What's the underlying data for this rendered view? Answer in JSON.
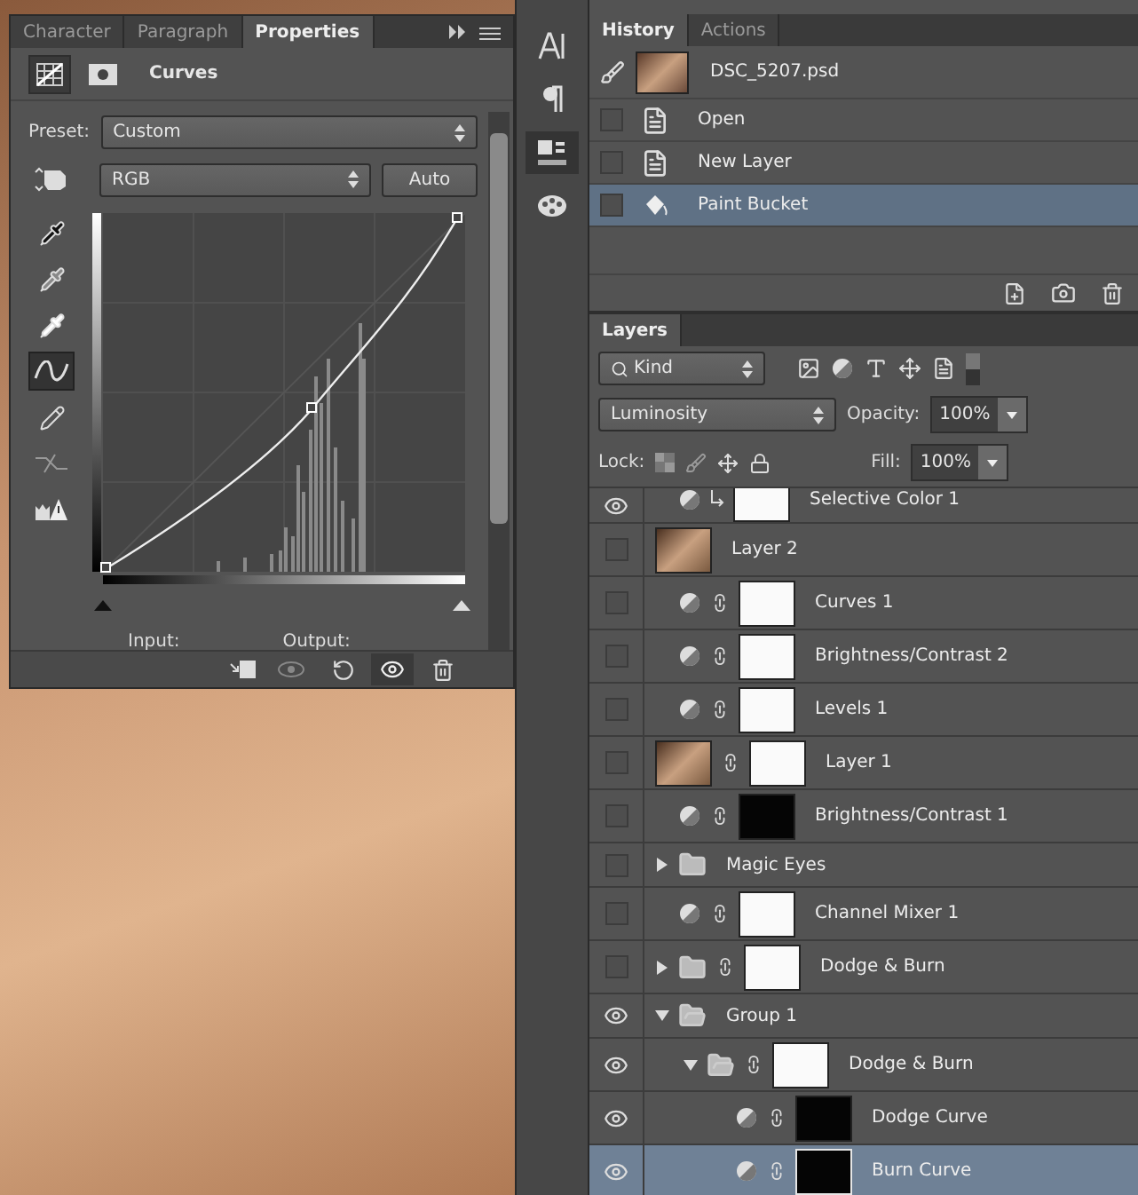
{
  "properties": {
    "tabs": [
      {
        "label": "Character",
        "selected": false
      },
      {
        "label": "Paragraph",
        "selected": false
      },
      {
        "label": "Properties",
        "selected": true
      }
    ],
    "title": "Curves",
    "preset_label": "Preset:",
    "preset": "Custom",
    "channel": "RGB",
    "auto_button": "Auto",
    "tools": [
      {
        "kind": "target-adjust",
        "selected": false
      },
      {
        "kind": "black-point",
        "selected": false
      },
      {
        "kind": "gray-point",
        "selected": false
      },
      {
        "kind": "white-point",
        "selected": false
      },
      {
        "kind": "curve",
        "selected": true
      },
      {
        "kind": "pencil",
        "selected": false
      },
      {
        "kind": "smooth",
        "selected": false
      },
      {
        "kind": "clipping",
        "selected": false
      }
    ],
    "input_label": "Input:",
    "output_label": "Output:",
    "footer_buttons": [
      {
        "kind": "clip",
        "pressed": false
      },
      {
        "kind": "previous",
        "pressed": false
      },
      {
        "kind": "reset",
        "pressed": false
      },
      {
        "kind": "visibility",
        "pressed": true
      },
      {
        "kind": "delete",
        "pressed": false
      }
    ]
  },
  "dock": [
    {
      "kind": "character",
      "selected": false
    },
    {
      "kind": "paragraph",
      "selected": false
    },
    {
      "kind": "properties",
      "selected": true
    },
    {
      "kind": "swatches",
      "selected": false
    }
  ],
  "history": {
    "tabs": [
      {
        "label": "History",
        "selected": true
      },
      {
        "label": "Actions",
        "selected": false
      }
    ],
    "snapshot": "DSC_5207.psd",
    "states": [
      {
        "label": "Open",
        "kind": "document",
        "selected": false
      },
      {
        "label": "New Layer",
        "kind": "document",
        "selected": false
      },
      {
        "label": "Paint Bucket",
        "kind": "bucket",
        "selected": true
      }
    ]
  },
  "layers": {
    "tab": "Layers",
    "filter": "Kind",
    "blend_mode": "Luminosity",
    "opacity_label": "Opacity:",
    "opacity": "100%",
    "lock_label": "Lock:",
    "fill_label": "Fill:",
    "fill": "100%",
    "items": [
      {
        "name": "Selective Color 1",
        "kind": "adjustment",
        "visible": true,
        "clipped": true,
        "mask": true,
        "mask_dark": false,
        "selected": false
      },
      {
        "name": "Layer 2",
        "kind": "pixel",
        "visible": false,
        "clipped": false,
        "mask": false,
        "selected": false
      },
      {
        "name": "Curves 1",
        "kind": "adjustment",
        "visible": false,
        "clipped": false,
        "mask": true,
        "mask_dark": false,
        "selected": false
      },
      {
        "name": "Brightness/Contrast 2",
        "kind": "adjustment",
        "visible": false,
        "clipped": false,
        "mask": true,
        "mask_dark": false,
        "selected": false
      },
      {
        "name": "Levels 1",
        "kind": "adjustment",
        "visible": false,
        "clipped": false,
        "mask": true,
        "mask_dark": false,
        "selected": false
      },
      {
        "name": "Layer 1",
        "kind": "pixel",
        "visible": false,
        "clipped": false,
        "mask": true,
        "mask_dark": false,
        "selected": false
      },
      {
        "name": "Brightness/Contrast 1",
        "kind": "adjustment",
        "visible": false,
        "clipped": false,
        "mask": true,
        "mask_dark": true,
        "selected": false
      },
      {
        "name": "Magic Eyes",
        "kind": "group",
        "visible": false,
        "clipped": false,
        "mask": false,
        "expanded": false,
        "selected": false
      },
      {
        "name": "Channel Mixer 1",
        "kind": "adjustment",
        "visible": false,
        "clipped": false,
        "mask": true,
        "mask_dark": false,
        "selected": false
      },
      {
        "name": "Dodge & Burn",
        "kind": "group",
        "visible": false,
        "clipped": false,
        "mask": true,
        "mask_dark": false,
        "expanded": false,
        "selected": false
      },
      {
        "name": "Group 1",
        "kind": "group",
        "visible": true,
        "clipped": false,
        "mask": false,
        "expanded": true,
        "selected": false,
        "children": [
          {
            "name": "Dodge & Burn",
            "kind": "group",
            "visible": true,
            "clipped": false,
            "mask": true,
            "mask_dark": false,
            "expanded": true,
            "selected": false,
            "children": [
              {
                "name": "Dodge Curve",
                "kind": "adjustment",
                "visible": true,
                "clipped": false,
                "mask": true,
                "mask_dark": true,
                "selected": false
              },
              {
                "name": "Burn Curve",
                "kind": "adjustment",
                "visible": true,
                "clipped": false,
                "mask": true,
                "mask_dark": true,
                "selected": true
              }
            ]
          }
        ]
      }
    ]
  }
}
